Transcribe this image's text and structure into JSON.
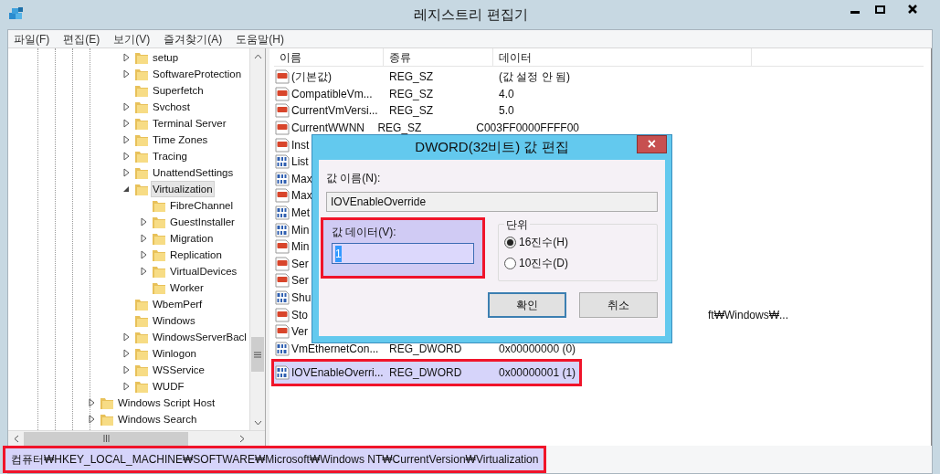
{
  "window": {
    "title": "레지스트리 편집기"
  },
  "menu": [
    "파일(F)",
    "편집(E)",
    "보기(V)",
    "즐겨찾기(A)",
    "도움말(H)"
  ],
  "tree": {
    "items": [
      {
        "children": [
          {
            "children": [
              {
                "label": "setup",
                "expandable": true,
                "selected": false
              },
              {
                "label": "SoftwareProtection",
                "expandable": true,
                "selected": false
              },
              {
                "label": "Superfetch",
                "expandable": false,
                "selected": false
              },
              {
                "label": "Svchost",
                "expandable": true,
                "selected": false
              },
              {
                "label": "Terminal Server",
                "expandable": true,
                "selected": false
              },
              {
                "label": "Time Zones",
                "expandable": true,
                "selected": false
              },
              {
                "label": "Tracing",
                "expandable": true,
                "selected": false
              },
              {
                "label": "UnattendSettings",
                "expandable": true,
                "selected": false
              },
              {
                "label": "Virtualization",
                "expandable": true,
                "expanded": true,
                "selected": true,
                "children": [
                  {
                    "label": "FibreChannel",
                    "expandable": false,
                    "selected": false
                  },
                  {
                    "label": "GuestInstaller",
                    "expandable": true,
                    "selected": false
                  },
                  {
                    "label": "Migration",
                    "expandable": true,
                    "selected": false
                  },
                  {
                    "label": "Replication",
                    "expandable": true,
                    "selected": false
                  },
                  {
                    "label": "VirtualDevices",
                    "expandable": true,
                    "selected": false
                  },
                  {
                    "label": "Worker",
                    "expandable": false,
                    "selected": false
                  }
                ]
              },
              {
                "label": "WbemPerf",
                "expandable": false,
                "selected": false
              },
              {
                "label": "Windows",
                "expandable": false,
                "selected": false
              },
              {
                "label": "WindowsServerBacl",
                "expandable": true,
                "selected": false
              },
              {
                "label": "Winlogon",
                "expandable": true,
                "selected": false
              },
              {
                "label": "WSService",
                "expandable": true,
                "selected": false
              },
              {
                "label": "WUDF",
                "expandable": true,
                "selected": false
              }
            ]
          }
        ]
      },
      {
        "label": "Windows Script Host",
        "expandable": true,
        "selected": false
      },
      {
        "label": "Windows Search",
        "expandable": true,
        "selected": false
      }
    ]
  },
  "list": {
    "columns": [
      "이름",
      "종류",
      "데이터"
    ],
    "rows": [
      {
        "kind": "string",
        "name": "(기본값)",
        "type": "REG_SZ",
        "data": "(값 설정 안 됨)",
        "selected": false,
        "annotated": false
      },
      {
        "kind": "string",
        "name": "CompatibleVm...",
        "type": "REG_SZ",
        "data": "4.0",
        "selected": false,
        "annotated": false
      },
      {
        "kind": "string",
        "name": "CurrentVmVersi...",
        "type": "REG_SZ",
        "data": "5.0",
        "selected": false,
        "annotated": false
      },
      {
        "kind": "string",
        "name": "CurrentWWNN",
        "type": "REG_SZ",
        "data": "C003FF0000FFFF00",
        "selected": false,
        "annotated": false
      },
      {
        "kind": "string",
        "name": "Inst",
        "selected": false,
        "annotated": false
      },
      {
        "kind": "binary",
        "name": "List",
        "selected": false,
        "annotated": false
      },
      {
        "kind": "binary",
        "name": "Max",
        "selected": false,
        "annotated": false
      },
      {
        "kind": "string",
        "name": "Max",
        "selected": false,
        "annotated": false
      },
      {
        "kind": "binary",
        "name": "Met",
        "selected": false,
        "annotated": false
      },
      {
        "kind": "binary",
        "name": "Min",
        "selected": false,
        "annotated": false
      },
      {
        "kind": "string",
        "name": "Min",
        "selected": false,
        "annotated": false
      },
      {
        "kind": "string",
        "name": "Ser",
        "selected": false,
        "annotated": false
      },
      {
        "kind": "string",
        "name": "Ser",
        "selected": false,
        "annotated": false
      },
      {
        "kind": "binary",
        "name": "Shu",
        "selected": false,
        "annotated": false
      },
      {
        "kind": "string",
        "name": "Sto",
        "data": "ft₩Windows₩...",
        "selected": false,
        "annotated": false
      },
      {
        "kind": "string",
        "name": "Ver",
        "selected": false,
        "annotated": false
      },
      {
        "kind": "binary",
        "name": "VmEthernetCon...",
        "type": "REG_DWORD",
        "data": "0x00000000 (0)",
        "selected": false,
        "annotated": false
      },
      {
        "kind": "binary",
        "name": "IOVEnableOverri...",
        "type": "REG_DWORD",
        "data": "0x00000001 (1)",
        "selected": true,
        "annotated": true
      }
    ]
  },
  "dialog": {
    "title": "DWORD(32비트) 값 편집",
    "close": "×",
    "name_label": "값 이름(N):",
    "name_value": "IOVEnableOverride",
    "data_label": "값 데이터(V):",
    "data_value": "1",
    "data_annotated": true,
    "base_label": "단위",
    "radios": [
      {
        "label": "16진수(H)",
        "selected": true
      },
      {
        "label": "10진수(D)",
        "selected": false
      }
    ],
    "buttons": [
      {
        "label": "확인",
        "focused": true
      },
      {
        "label": "취소",
        "focused": false
      }
    ]
  },
  "status_bar": {
    "text": "컴퓨터₩HKEY_LOCAL_MACHINE₩SOFTWARE₩Microsoft₩Windows NT₩CurrentVersion₩Virtualization",
    "annotated": true
  }
}
